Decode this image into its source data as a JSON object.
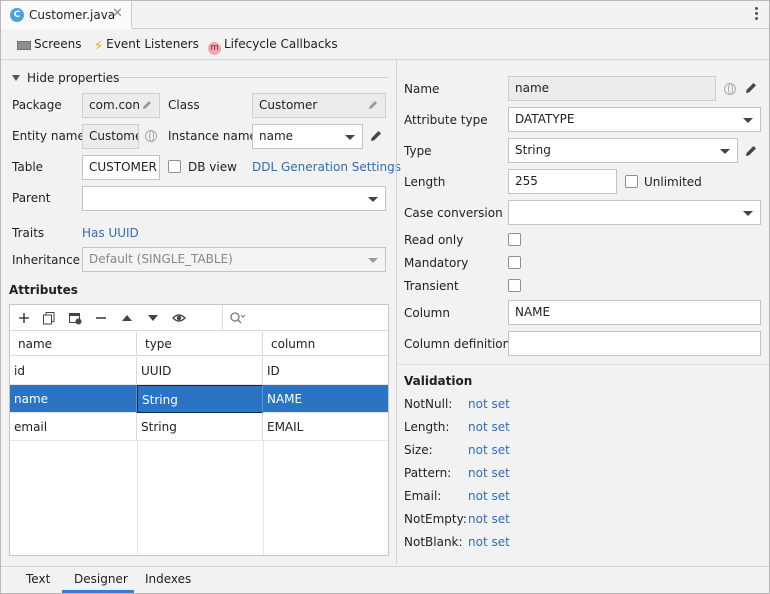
{
  "file_tab": {
    "icon": "C",
    "title": "Customer.java",
    "close": "✕"
  },
  "toolbar": {
    "screens": "Screens",
    "event_listeners": "Event Listeners",
    "lifecycle_callbacks": "Lifecycle Callbacks",
    "lifecycle_icon": "m"
  },
  "properties": {
    "toggle_label": "Hide properties",
    "package_label": "Package",
    "package_value": "com.con",
    "class_label": "Class",
    "class_value": "Customer",
    "entity_name_label": "Entity name",
    "entity_name_value": "Custome",
    "instance_name_label": "Instance name",
    "instance_name_value": "name",
    "table_label": "Table",
    "table_value": "CUSTOMER",
    "db_view_label": "DB view",
    "db_view_checked": false,
    "ddl_link": "DDL Generation Settings",
    "parent_label": "Parent",
    "parent_value": "",
    "traits_label": "Traits",
    "traits_link": "Has UUID",
    "inheritance_label": "Inheritance",
    "inheritance_value": "Default (SINGLE_TABLE)"
  },
  "attributes": {
    "title": "Attributes",
    "columns": [
      "name",
      "type",
      "column"
    ],
    "rows": [
      {
        "name": "id",
        "type": "UUID",
        "column": "ID"
      },
      {
        "name": "name",
        "type": "String",
        "column": "NAME"
      },
      {
        "name": "email",
        "type": "String",
        "column": "EMAIL"
      }
    ],
    "selected_row": 1
  },
  "details": {
    "name_label": "Name",
    "name_value": "name",
    "attribute_type_label": "Attribute type",
    "attribute_type_value": "DATATYPE",
    "type_label": "Type",
    "type_value": "String",
    "length_label": "Length",
    "length_value": "255",
    "unlimited_label": "Unlimited",
    "case_conversion_label": "Case conversion",
    "case_conversion_value": "",
    "read_only_label": "Read only",
    "mandatory_label": "Mandatory",
    "transient_label": "Transient",
    "column_label": "Column",
    "column_value": "NAME",
    "column_definition_label": "Column definition",
    "column_definition_value": ""
  },
  "validation": {
    "title": "Validation",
    "items": [
      {
        "label": "NotNull:",
        "value": "not set"
      },
      {
        "label": "Length:",
        "value": "not set"
      },
      {
        "label": "Size:",
        "value": "not set"
      },
      {
        "label": "Pattern:",
        "value": "not set"
      },
      {
        "label": "Email:",
        "value": "not set"
      },
      {
        "label": "NotEmpty:",
        "value": "not set"
      },
      {
        "label": "NotBlank:",
        "value": "not set"
      }
    ]
  },
  "bottom_tabs": {
    "text": "Text",
    "designer": "Designer",
    "indexes": "Indexes",
    "active": "Designer"
  },
  "colors": {
    "accent": "#2a74c3",
    "link": "#2f6db5",
    "bolt": "#e9a800"
  }
}
